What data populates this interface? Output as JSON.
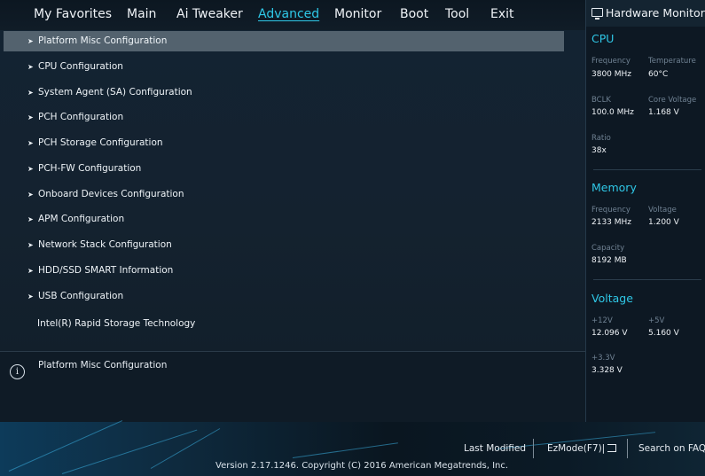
{
  "nav": {
    "tabs": [
      "My Favorites",
      "Main",
      "Ai Tweaker",
      "Advanced",
      "Monitor",
      "Boot",
      "Tool",
      "Exit"
    ],
    "active": "Advanced"
  },
  "menu": {
    "items": [
      {
        "label": "Platform Misc Configuration",
        "arrow": "➤"
      },
      {
        "label": "CPU Configuration",
        "arrow": "➤"
      },
      {
        "label": "System Agent (SA) Configuration",
        "arrow": "➤"
      },
      {
        "label": "PCH Configuration",
        "arrow": "➤"
      },
      {
        "label": "PCH Storage Configuration",
        "arrow": "➤"
      },
      {
        "label": "PCH-FW Configuration",
        "arrow": "➤"
      },
      {
        "label": "Onboard Devices Configuration",
        "arrow": "➤"
      },
      {
        "label": "APM Configuration",
        "arrow": "➤"
      },
      {
        "label": "Network Stack Configuration",
        "arrow": "➤"
      },
      {
        "label": "HDD/SSD SMART Information",
        "arrow": "➤"
      },
      {
        "label": "USB Configuration",
        "arrow": "➤"
      },
      {
        "label": "Intel(R) Rapid Storage Technology",
        "arrow": ""
      }
    ],
    "selected_index": 0
  },
  "help": {
    "icon": "info-icon",
    "icon_glyph": "i",
    "text": "Platform Misc Configuration"
  },
  "hw_monitor": {
    "title": "Hardware Monitor",
    "icon": "monitor-icon",
    "cpu": {
      "heading": "CPU",
      "frequency_label": "Frequency",
      "frequency": "3800 MHz",
      "temperature_label": "Temperature",
      "temperature": "60°C",
      "bclk_label": "BCLK",
      "bclk": "100.0 MHz",
      "core_voltage_label": "Core Voltage",
      "core_voltage": "1.168 V",
      "ratio_label": "Ratio",
      "ratio": "38x"
    },
    "memory": {
      "heading": "Memory",
      "frequency_label": "Frequency",
      "frequency": "2133 MHz",
      "voltage_label": "Voltage",
      "voltage": "1.200 V",
      "capacity_label": "Capacity",
      "capacity": "8192 MB"
    },
    "voltage": {
      "heading": "Voltage",
      "v12_label": "+12V",
      "v12": "12.096 V",
      "v5_label": "+5V",
      "v5": "5.160 V",
      "v33_label": "+3.3V",
      "v33": "3.328 V"
    }
  },
  "footer": {
    "last_modified": "Last Modified",
    "ezmode": "EzMode(F7)|",
    "search": "Search on FAQ",
    "version": "Version 2.17.1246. Copyright (C) 2016 American Megatrends, Inc."
  },
  "colors": {
    "accent": "#2fc7e6",
    "selected_row": "#53626e",
    "panel": "#132332"
  }
}
